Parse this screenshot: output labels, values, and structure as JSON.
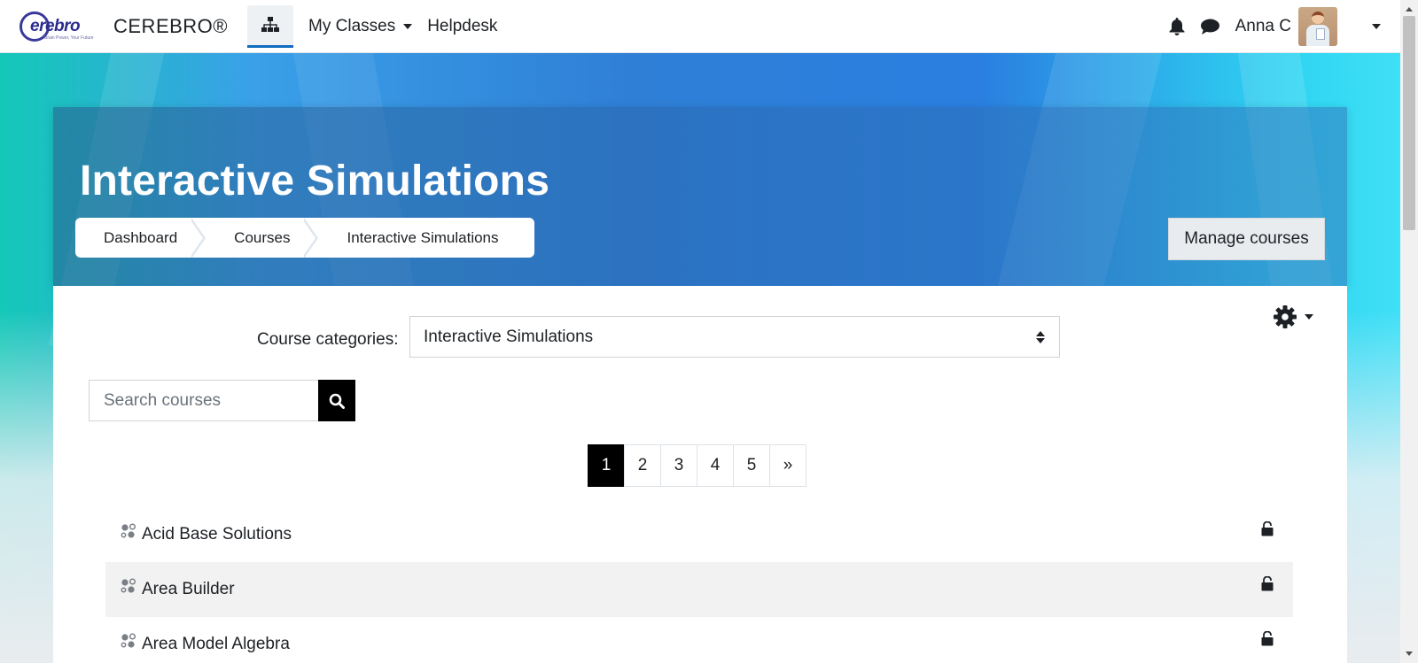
{
  "navbar": {
    "logo_text": "erebro",
    "logo_tagline": "Brain Power, Your Future",
    "brand_name": "CEREBRO®",
    "menu": [
      {
        "label": "My Classes"
      },
      {
        "label": "Helpdesk"
      }
    ],
    "user_name": "Anna C"
  },
  "header": {
    "title": "Interactive Simulations",
    "breadcrumb": [
      "Dashboard",
      "Courses",
      "Interactive Simulations"
    ],
    "manage_button": "Manage courses"
  },
  "filters": {
    "category_label": "Course categories:",
    "category_selected": "Interactive Simulations",
    "search_placeholder": "Search courses"
  },
  "pagination": {
    "pages": [
      "1",
      "2",
      "3",
      "4",
      "5"
    ],
    "next": "»",
    "current": "1"
  },
  "courses": [
    {
      "name": "Acid Base Solutions"
    },
    {
      "name": "Area Builder"
    },
    {
      "name": "Area Model Algebra"
    }
  ],
  "colors": {
    "accent": "#0f6cbf",
    "active_page": "#000000",
    "row_highlight": "#f2f2f2"
  },
  "icons": {
    "home": "sitemap-icon",
    "notifications": "bell-icon",
    "messages": "chat-icon",
    "settings": "gear-icon",
    "search": "search-icon",
    "course": "course-category-icon",
    "lock": "unlock-icon"
  }
}
